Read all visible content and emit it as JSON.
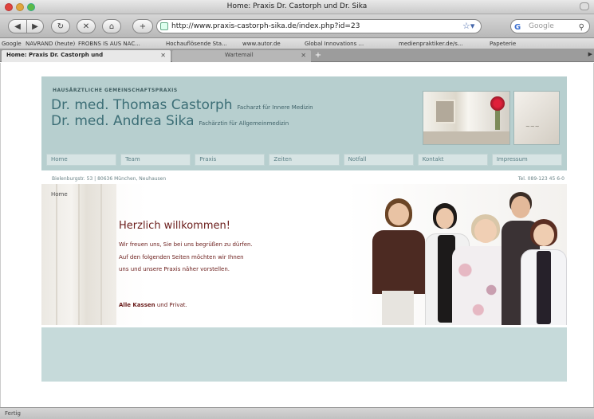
{
  "window": {
    "title": "Home: Praxis Dr. Castorph und Dr. Sika"
  },
  "toolbar": {
    "url": "http://www.praxis-castorph-sika.de/index.php?id=23",
    "search_placeholder": "Google"
  },
  "bookmarks": [
    "Google",
    "NAVRAND (heute)",
    "FROBNS IS AUS NAC...",
    "Hochauflösende Sta...",
    "www.autor.de",
    "Global Innovations ...",
    "medienpraktiker.de/s...",
    "Papeterie"
  ],
  "tabs": [
    {
      "label": "Home: Praxis Dr. Castorph und",
      "active": true
    },
    {
      "label": "Wartemail",
      "active": false
    }
  ],
  "status_text": "Fertig",
  "site": {
    "eyebrow": "HAUSÄRZTLICHE GEMEINSCHAFTSPRAXIS",
    "doctor1_name": "Dr. med. Thomas Castorph",
    "doctor1_specialty": "Facharzt für Innere Medizin",
    "doctor2_name": "Dr. med. Andrea Sika",
    "doctor2_specialty": "Fachärztin für Allgemeinmedizin",
    "nav": [
      "Home",
      "Team",
      "Praxis",
      "Zeiten",
      "Notfall",
      "Kontakt",
      "Impressum"
    ],
    "address": "Bielenburgstr. 53 | 80636 München, Neuhausen",
    "phone": "Tel. 089-123 45 6-0",
    "breadcrumb": "Home",
    "welcome_heading": "Herzlich willkommen!",
    "intro_lines": [
      "Wir freuen uns, Sie bei uns begrüßen zu dürfen.",
      "Auf den folgenden Seiten möchten wir Ihnen",
      "uns und unsere Praxis näher vorstellen."
    ],
    "insurance_bold": "Alle Kassen",
    "insurance_rest": " und Privat."
  },
  "colors": {
    "header_bg": "#b7cfcf",
    "nav_bg": "#d7e4e4",
    "text_teal": "#3c6e76",
    "text_maroon": "#6a1c1a",
    "footer_band": "#c6dada"
  }
}
